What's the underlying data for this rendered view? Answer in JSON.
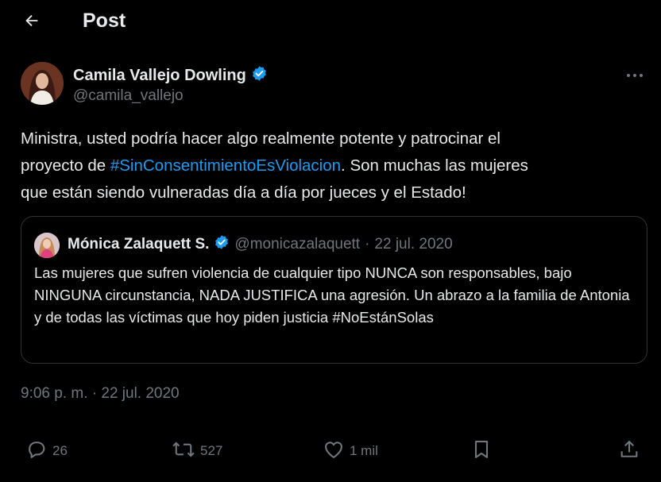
{
  "header": {
    "title": "Post"
  },
  "tweet": {
    "author": {
      "name": "Camila Vallejo Dowling",
      "handle": "@camila_vallejo"
    },
    "text": {
      "line1": "Ministra, usted podría hacer algo realmente potente y patrocinar el",
      "line2_before": "proyecto de ",
      "hashtag": "#SinConsentimientoEsViolacion",
      "line2_after": ".  Son muchas las mujeres",
      "line3": "que están siendo vulneradas día a día por jueces y el Estado!"
    },
    "quote": {
      "author": {
        "name": "Mónica Zalaquett S.",
        "handle": "@monicazalaquett",
        "separator": "·",
        "date": "22 jul. 2020"
      },
      "text": "Las mujeres que sufren violencia de cualquier tipo NUNCA son responsables, bajo NINGUNA circunstancia, NADA JUSTIFICA una agresión. Un abrazo a la familia de Antonia y de todas las víctimas que hoy piden justicia #NoEstánSolas"
    },
    "timestamp": "9:06 p. m. · 22 jul. 2020",
    "actions": {
      "replies": "26",
      "reposts": "527",
      "likes": "1 mil"
    }
  },
  "icons": {
    "back": "arrow-left-icon",
    "verified": "verified-badge-icon",
    "more": "more-horizontal-icon",
    "reply": "reply-icon",
    "repost": "repost-icon",
    "like": "heart-icon",
    "bookmark": "bookmark-icon",
    "share": "share-icon"
  },
  "colors": {
    "background": "#000000",
    "text": "#e7e9ea",
    "muted": "#71767b",
    "accent": "#1d9bf0",
    "border": "#2f3336"
  }
}
